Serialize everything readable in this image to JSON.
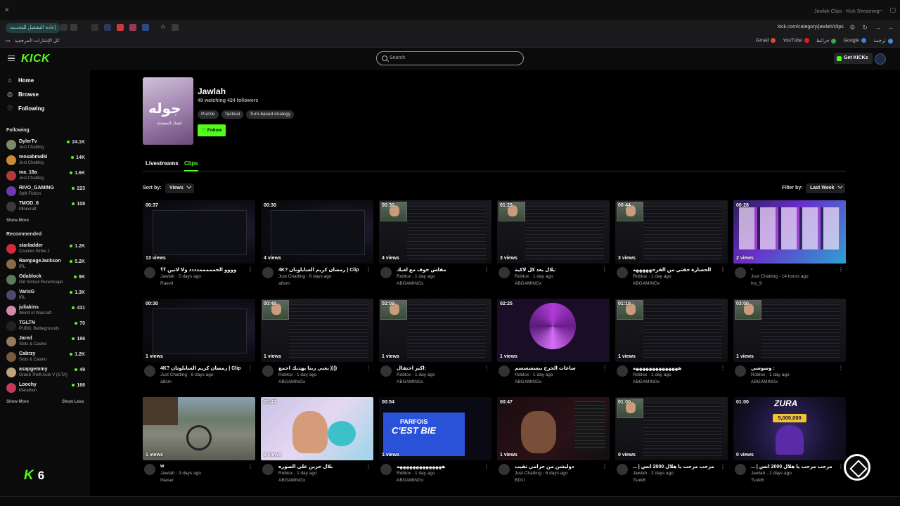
{
  "browser": {
    "window_title": "Jawlah Clips · Kick Streaming",
    "reload_chip": "إعادة التشغيل للتحديث",
    "url": "kick.com/category/jawlah/clips",
    "bookmarks_left": "كل الإشارات المرجعية",
    "bookmarks": [
      "ترجمة",
      "Google",
      "خرائط",
      "YouTube",
      "Gmail"
    ]
  },
  "topbar": {
    "logo": "KICK",
    "search_placeholder": "Search",
    "get_kicks": "Get KICKs"
  },
  "sidebar": {
    "nav": [
      {
        "label": "Home",
        "icon": "home-icon"
      },
      {
        "label": "Browse",
        "icon": "compass-icon"
      },
      {
        "label": "Following",
        "icon": "heart-icon"
      }
    ],
    "following_heading": "Following",
    "following": [
      {
        "name": "DylerTv",
        "category": "Just Chatting",
        "viewers": "24.1K",
        "color": "#7a8a6a"
      },
      {
        "name": "mosabmalki",
        "category": "Just Chatting",
        "viewers": "14K",
        "color": "#c98b3a"
      },
      {
        "name": "ma_18a",
        "category": "Just Chatting",
        "viewers": "1.6K",
        "color": "#b23a3a"
      },
      {
        "name": "RIVO_GAMING",
        "category": "Split Fiction",
        "viewers": "223",
        "color": "#6a3ab2"
      },
      {
        "name": "7MOD_6",
        "category": "Minecraft",
        "viewers": "108",
        "color": "#3a3a3a"
      }
    ],
    "show_more": "Show More",
    "recommended_heading": "Recommended",
    "recommended": [
      {
        "name": "starladder",
        "category": "Counter-Strike 2",
        "viewers": "1.2K",
        "color": "#d22a3a"
      },
      {
        "name": "RampageJackson",
        "category": "IRL",
        "viewers": "5.2K",
        "color": "#8a6a4a"
      },
      {
        "name": "Odablock",
        "category": "Old School RuneScape",
        "viewers": "9K",
        "color": "#5a7a5a"
      },
      {
        "name": "VarisG",
        "category": "IRL",
        "viewers": "1.3K",
        "color": "#4a4a6a"
      },
      {
        "name": "juliakins",
        "category": "World of Warcraft",
        "viewers": "431",
        "color": "#d28aa8"
      },
      {
        "name": "TGLTN",
        "category": "PUBG: Battlegrounds",
        "viewers": "70",
        "color": "#222"
      },
      {
        "name": "Jared",
        "category": "Slots & Casino",
        "viewers": "186",
        "color": "#9a7a5a"
      },
      {
        "name": "Cabrzy",
        "category": "Slots & Casino",
        "viewers": "1.2K",
        "color": "#7a5a3a"
      },
      {
        "name": "asapgemmy",
        "category": "Grand Theft Auto V (GTA)",
        "viewers": "49",
        "color": "#c2a27a"
      },
      {
        "name": "Loochy",
        "category": "Marathon",
        "viewers": "166",
        "color": "#c23a5a"
      }
    ],
    "show_more_2": "Show More",
    "show_less": "Show Less",
    "overlay_number": "6"
  },
  "category": {
    "image_text": "جوله",
    "image_sub": "لعبتك المفضلة",
    "title": "Jawlah",
    "stats": "49 watching  424 followers",
    "tags": [
      "Puzzle",
      "Tactical",
      "Turn-based strategy"
    ],
    "follow_label": "Follow"
  },
  "tabs": {
    "livestreams": "Livestreams",
    "clips": "Clips"
  },
  "sort": {
    "label": "Sort by:",
    "value": "Views"
  },
  "filter": {
    "label": "Filter by:",
    "value": "Last Week"
  },
  "clips": [
    {
      "duration": "00:37",
      "views": "13 views",
      "title": "وووو الحمممممدددد ولا لاتين ؟؟",
      "sub": "Jawlah · 5 days ago",
      "creator": "Raevil",
      "thumb": "th-dark"
    },
    {
      "duration": "00:30",
      "views": "4 views",
      "title": "4K? رمضان كريم السابلوتان | Clip",
      "sub": "Just Chatting · 6 days ago",
      "creator": "a8sm",
      "thumb": "th-dark"
    },
    {
      "duration": "00:30",
      "views": "4 views",
      "title": "مقلش خوف مع لعبك",
      "sub": "Roblox · 1 day ago",
      "creator": "ABGAMINGx",
      "thumb": "th-code"
    },
    {
      "duration": "01:25",
      "views": "3 views",
      "title": "بلال بعد كل لاكية:",
      "sub": "Roblox · 1 day ago",
      "creator": "ABGAMINGx",
      "thumb": "th-code"
    },
    {
      "duration": "00:44",
      "views": "3 views",
      "title": "الحسارة حقتي من القرحهههههه",
      "sub": "Roblox · 1 day ago",
      "creator": "ABGAMINGx",
      "thumb": "th-code"
    },
    {
      "duration": "00:28",
      "views": "2 views",
      "title": "-",
      "sub": "Just Chatting · 14 hours ago",
      "creator": "lns_9",
      "thumb": "th-colorful"
    },
    {
      "duration": "00:30",
      "views": "1 views",
      "title": "4K? رمضان كريم السابلوتان | Clip",
      "sub": "Just Chatting · 6 days ago",
      "creator": "a8sm",
      "thumb": "th-dark"
    },
    {
      "duration": "00:48",
      "views": "1 views",
      "title": "يعني ربنا يهديك احمع ))))",
      "sub": "Roblox · 1 day ago",
      "creator": "ABGAMINGx",
      "thumb": "th-code"
    },
    {
      "duration": "02:09",
      "views": "1 views",
      "title": "اكبر احتفال:",
      "sub": "Roblox · 1 day ago",
      "creator": "ABGAMINGx",
      "thumb": "th-code"
    },
    {
      "duration": "02:25",
      "views": "1 views",
      "title": "ساعات الحرح بيسسسسم",
      "sub": "Roblox · 1 day ago",
      "creator": "ABGAMINGx",
      "thumb": "th-purple"
    },
    {
      "duration": "01:10",
      "views": "1 views",
      "title": "ههههههههههههههه",
      "sub": "Roblox · 1 day ago",
      "creator": "ABGAMINGx",
      "thumb": "th-code"
    },
    {
      "duration": "03:00",
      "views": "1 views",
      "title": "وسوسي :",
      "sub": "Roblox · 1 day ago",
      "creator": "ABGAMINGx",
      "thumb": "th-code"
    },
    {
      "duration": "00:16",
      "views": "1 views",
      "title": "w",
      "sub": "Jawlah · 3 days ago",
      "creator": "INaser",
      "thumb": "th-gta"
    },
    {
      "duration": "00:47",
      "views": "1 views",
      "title": "بلال حزين على الصوره",
      "sub": "Roblox · 1 day ago",
      "creator": "ABGAMINGx",
      "thumb": "th-laugh"
    },
    {
      "duration": "00:54",
      "views": "1 views",
      "title": "ههههههههههههههه",
      "sub": "Roblox · 1 day ago",
      "creator": "ABGAMINGx",
      "thumb": "th-blue",
      "extra1": "PARFOIS",
      "extra2": "C'EST BIE"
    },
    {
      "duration": "00:47",
      "views": "1 views",
      "title": "دوليشن من حرامي تقيب",
      "sub": "Just Chatting · 6 days ago",
      "creator": "BD1I",
      "thumb": "th-stream"
    },
    {
      "duration": "01:00",
      "views": "0 views",
      "title": "... | مرحب مرحب يا هلال 2000 انس",
      "sub": "Jawlah · 2 days ago",
      "creator": "Tsuki6",
      "thumb": "th-code"
    },
    {
      "duration": "01:00",
      "views": "0 views",
      "title": "... | مرحب مرحب يا هلال 2000 انس",
      "sub": "Jawlah · 2 days ago",
      "creator": "Tsuki6",
      "thumb": "th-promo",
      "extra1": "ZURA",
      "extra2": "5,000,000"
    }
  ]
}
